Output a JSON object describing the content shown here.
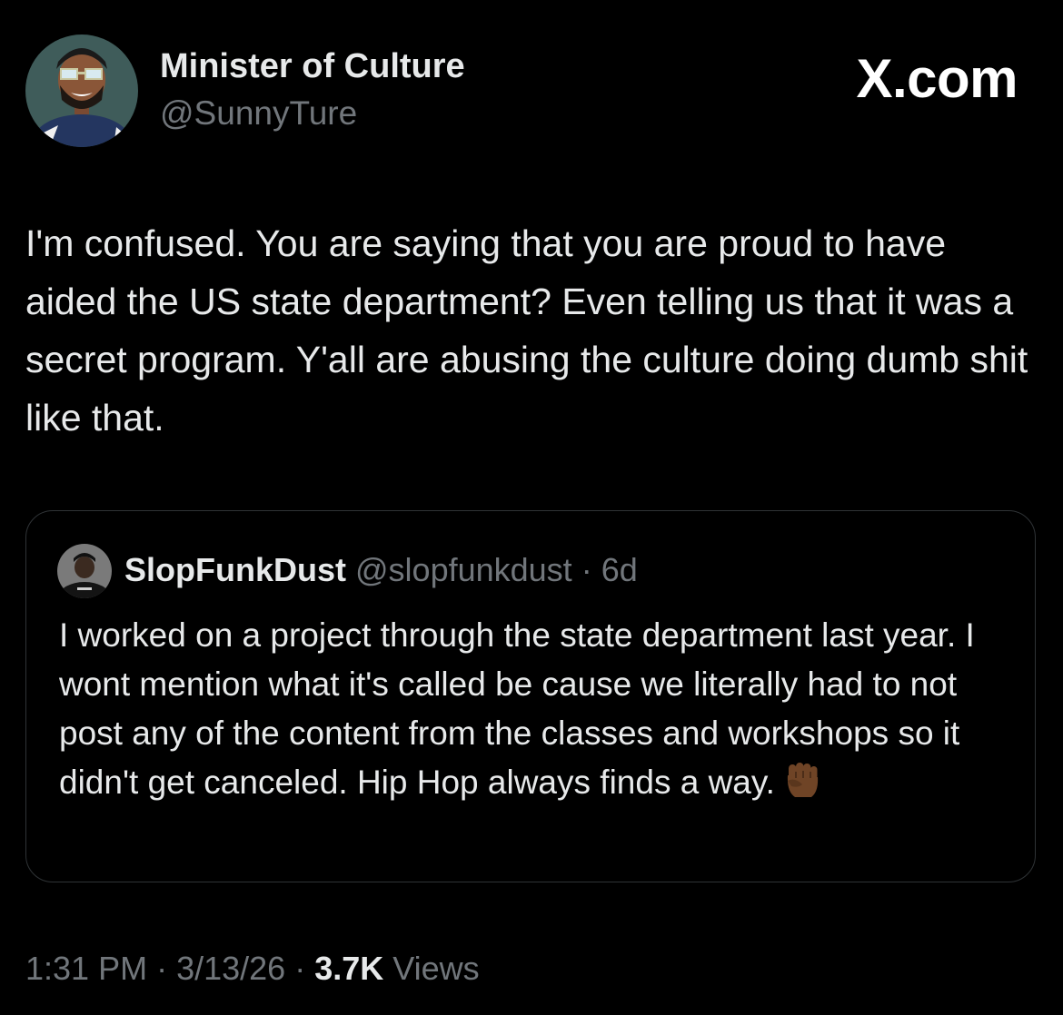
{
  "author": {
    "name": "Minister of Culture",
    "handle": "@SunnyTure"
  },
  "brand": {
    "label": "X.com"
  },
  "tweet": {
    "text": "I'm confused. You are saying that you are proud to have aided the US state department? Even telling us that it was a secret program. Y'all are abusing the culture doing dumb shit like that."
  },
  "quote": {
    "name": "SlopFunkDust",
    "handle": "@slopfunkdust",
    "separator": " · ",
    "age": "6d",
    "text": "I worked on a project through the state department last year. I wont mention what it's called be cause we literally had to not post any of the content from the classes and workshops so it didn't get canceled. Hip Hop always finds a way.",
    "emoji": "raised-fist-icon"
  },
  "footer": {
    "time": "1:31 PM",
    "sep": " · ",
    "date": "3/13/26",
    "views_count": "3.7K",
    "views_label": "Views"
  },
  "colors": {
    "background": "#000000",
    "text_primary": "#e7e9ea",
    "text_secondary": "#71767b",
    "border": "#2f3336"
  }
}
